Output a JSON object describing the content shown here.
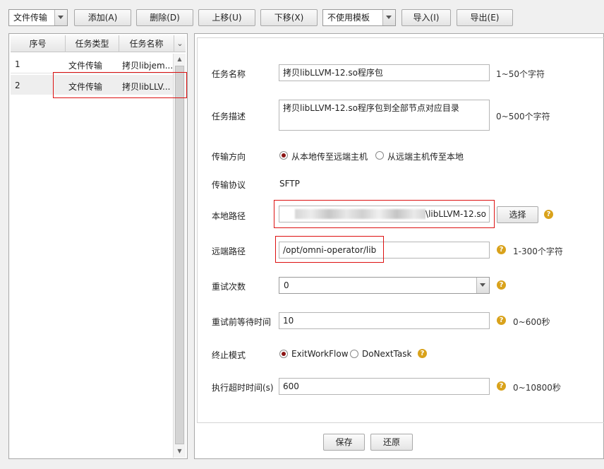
{
  "toolbar": {
    "type_select": "文件传输",
    "add": "添加(A)",
    "delete": "删除(D)",
    "move_up": "上移(U)",
    "move_down": "下移(X)",
    "template_select": "不使用模板",
    "import": "导入(I)",
    "export": "导出(E)"
  },
  "task_table": {
    "headers": [
      "序号",
      "任务类型",
      "任务名称"
    ],
    "rows": [
      {
        "index": "1",
        "type": "文件传输",
        "name": "拷贝libjem..."
      },
      {
        "index": "2",
        "type": "文件传输",
        "name": "拷贝libLLV..."
      }
    ],
    "selected_row": 2
  },
  "form": {
    "task_name": {
      "label": "任务名称",
      "value": "拷贝libLLVM-12.so程序包",
      "hint": "1~50个字符"
    },
    "task_desc": {
      "label": "任务描述",
      "value": "拷贝libLLVM-12.so程序包到全部节点对应目录",
      "hint": "0~500个字符"
    },
    "direction": {
      "label": "传输方向",
      "option1": "从本地传至远端主机",
      "option2": "从远端主机传至本地",
      "selected": 1
    },
    "protocol": {
      "label": "传输协议",
      "value": "SFTP"
    },
    "local_path": {
      "label": "本地路径",
      "value_visible": "\\libLLVM-12.so",
      "choose": "选择"
    },
    "remote_path": {
      "label": "远端路径",
      "value": "/opt/omni-operator/lib",
      "hint": "1-300个字符"
    },
    "retry_count": {
      "label": "重试次数",
      "value": "0"
    },
    "retry_wait": {
      "label": "重试前等待时间",
      "value": "10",
      "hint": "0~600秒"
    },
    "stop_mode": {
      "label": "终止模式",
      "option1": "ExitWorkFlow",
      "option2": "DoNextTask",
      "selected": 1
    },
    "timeout": {
      "label": "执行超时时间(s)",
      "value": "600",
      "hint": "0~10800秒"
    }
  },
  "footer": {
    "save": "保存",
    "reset": "还原"
  },
  "colors": {
    "highlight_box": "#dd1111",
    "help_icon": "#d9a21b",
    "radio_dot": "#8c1515"
  }
}
